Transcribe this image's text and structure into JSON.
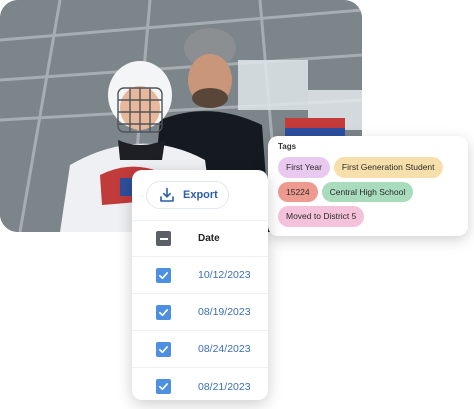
{
  "photo": {
    "description_icon": "hockey-player-with-coach-photo"
  },
  "tags_card": {
    "title": "Tags",
    "tags": [
      {
        "label": "First Year",
        "color": "#e9c9ef"
      },
      {
        "label": "First Generation Student",
        "color": "#f6dfaa"
      },
      {
        "label": "15224",
        "color": "#ee9a8e"
      },
      {
        "label": "Central High School",
        "color": "#a9dbbd"
      },
      {
        "label": "Moved to District 5",
        "color": "#f4c2da"
      }
    ]
  },
  "table_card": {
    "export_label": "Export",
    "export_icon": "download-tray-icon",
    "header": {
      "date_label": "Date",
      "select_all_state": "indeterminate"
    },
    "rows": [
      {
        "date": "10/12/2023",
        "checked": true
      },
      {
        "date": "08/19/2023",
        "checked": true
      },
      {
        "date": "08/24/2023",
        "checked": true
      },
      {
        "date": "08/21/2023",
        "checked": true
      }
    ]
  },
  "colors": {
    "accent": "#4d8fe0",
    "link_text": "#3b6fb5",
    "export_text": "#2c5fa8"
  }
}
